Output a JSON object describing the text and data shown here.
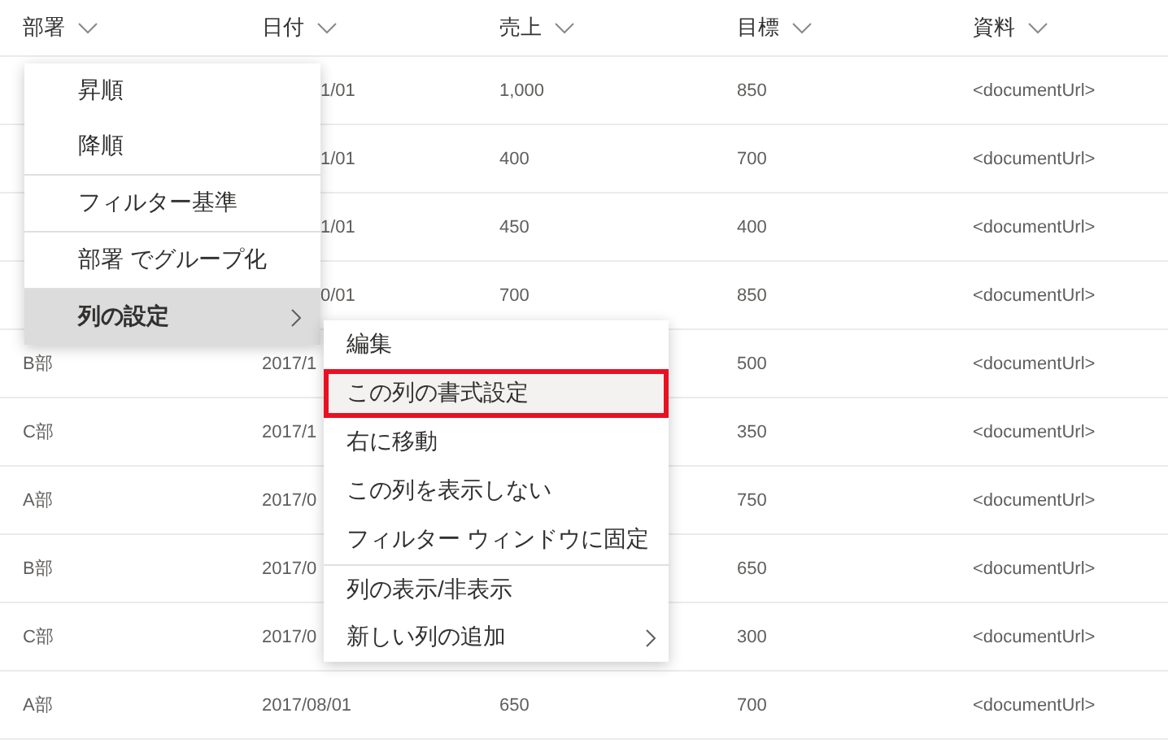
{
  "table": {
    "columns": [
      "部署",
      "日付",
      "売上",
      "目標",
      "資料"
    ],
    "rows": [
      {
        "cut": true,
        "cells": [
          "",
          "1/01",
          "1,000",
          "850",
          "<documentUrl>"
        ]
      },
      {
        "cut": true,
        "cells": [
          "",
          "1/01",
          "400",
          "700",
          "<documentUrl>"
        ]
      },
      {
        "cut": true,
        "cells": [
          "",
          "1/01",
          "450",
          "400",
          "<documentUrl>"
        ]
      },
      {
        "cut": true,
        "cells": [
          "",
          "0/01",
          "700",
          "850",
          "<documentUrl>"
        ]
      },
      {
        "cut": false,
        "cells": [
          "B部",
          "2017/1",
          "",
          "500",
          "<documentUrl>"
        ]
      },
      {
        "cut": false,
        "cells": [
          "C部",
          "2017/1",
          "",
          "350",
          "<documentUrl>"
        ]
      },
      {
        "cut": false,
        "cells": [
          "A部",
          "2017/0",
          "",
          "750",
          "<documentUrl>"
        ]
      },
      {
        "cut": false,
        "cells": [
          "B部",
          "2017/0",
          "",
          "650",
          "<documentUrl>"
        ]
      },
      {
        "cut": false,
        "cells": [
          "C部",
          "2017/0",
          "",
          "300",
          "<documentUrl>"
        ]
      },
      {
        "cut": false,
        "cells": [
          "A部",
          "2017/08/01",
          "650",
          "700",
          "<documentUrl>"
        ]
      }
    ]
  },
  "column_menu": {
    "items": [
      {
        "label": "昇順",
        "selected": false,
        "submenu": false,
        "divider_before": false
      },
      {
        "label": "降順",
        "selected": false,
        "submenu": false,
        "divider_before": false
      },
      {
        "label": "フィルター基準",
        "selected": false,
        "submenu": false,
        "divider_before": true
      },
      {
        "label": "部署 でグループ化",
        "selected": false,
        "submenu": false,
        "divider_before": true
      },
      {
        "label": "列の設定",
        "selected": true,
        "submenu": true,
        "divider_before": true
      }
    ]
  },
  "column_settings_menu": {
    "items": [
      {
        "label": "編集",
        "highlighted": false,
        "submenu": false,
        "divider_before": false
      },
      {
        "label": "この列の書式設定",
        "highlighted": true,
        "submenu": false,
        "divider_before": false
      },
      {
        "label": "右に移動",
        "highlighted": false,
        "submenu": false,
        "divider_before": false
      },
      {
        "label": "この列を表示しない",
        "highlighted": false,
        "submenu": false,
        "divider_before": false
      },
      {
        "label": "フィルター ウィンドウに固定",
        "highlighted": false,
        "submenu": false,
        "divider_before": false
      },
      {
        "label": "列の表示/非表示",
        "highlighted": false,
        "submenu": false,
        "divider_before": true
      },
      {
        "label": "新しい列の追加",
        "highlighted": false,
        "submenu": true,
        "divider_before": false
      }
    ]
  }
}
